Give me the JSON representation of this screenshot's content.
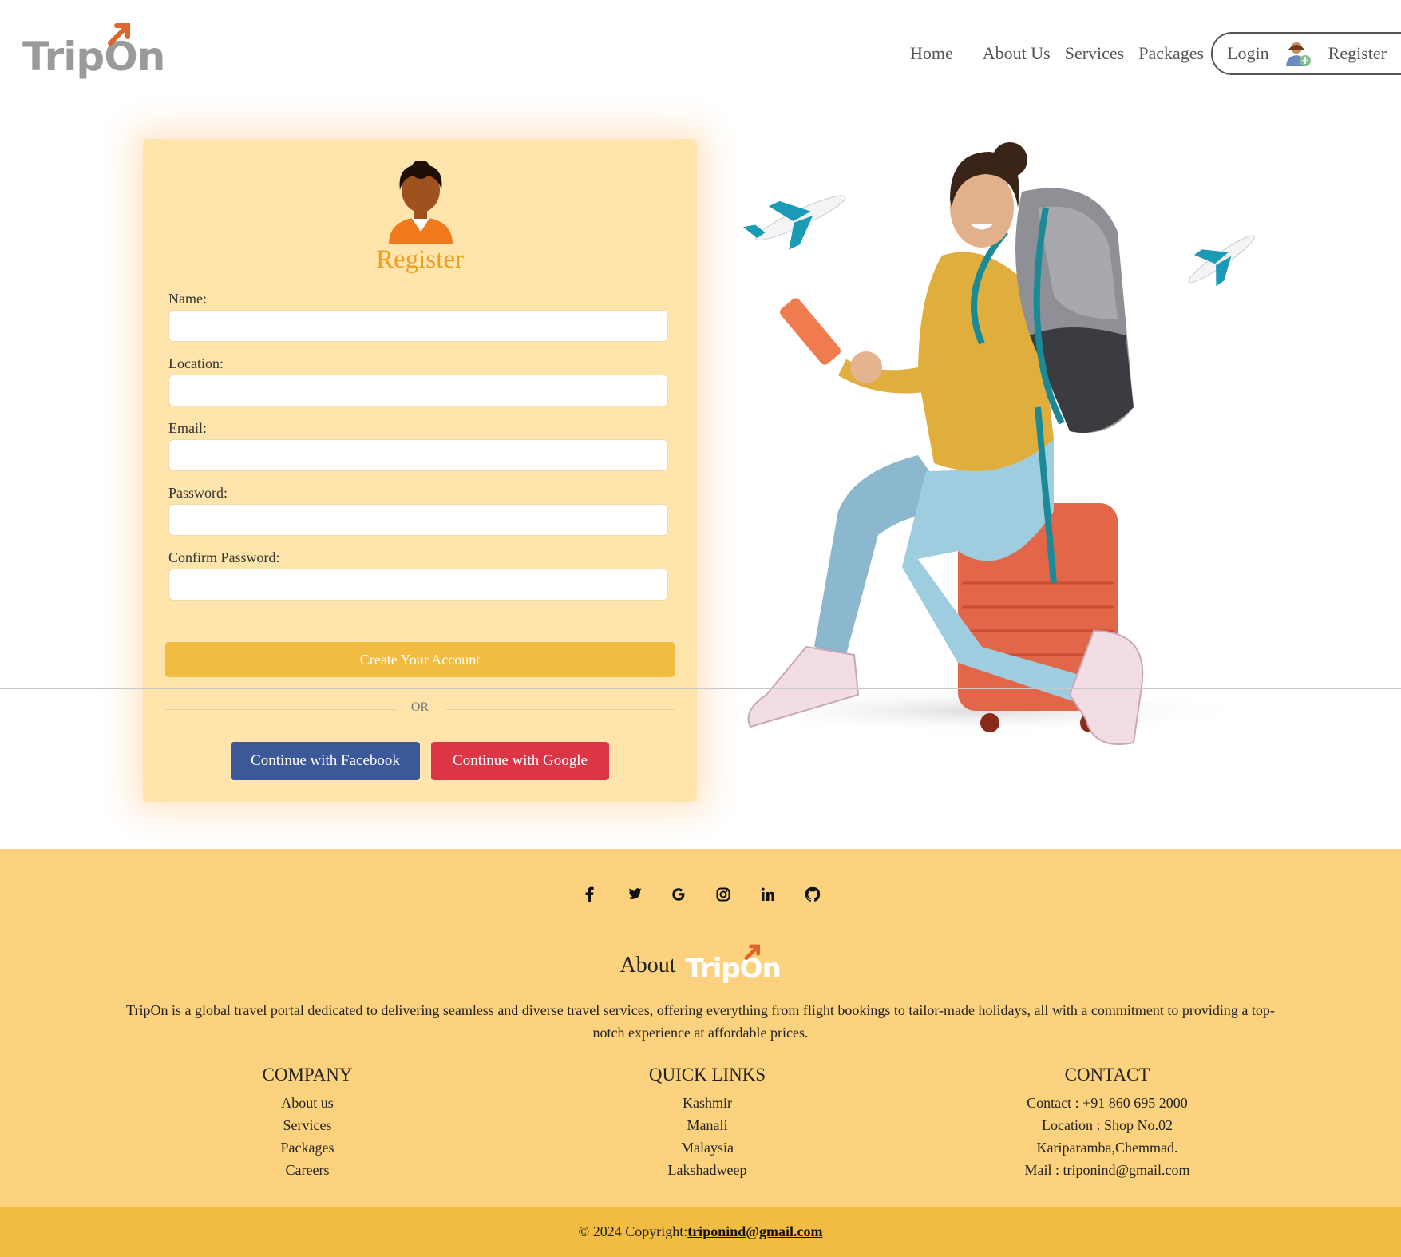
{
  "header": {
    "logo_text": "TripOn",
    "nav": {
      "home": "Home",
      "about": "About Us",
      "services": "Services",
      "packages": "Packages"
    },
    "auth": {
      "login": "Login",
      "register": "Register"
    }
  },
  "register_form": {
    "title": "Register",
    "fields": [
      {
        "label": "Name:",
        "value": ""
      },
      {
        "label": "Location:",
        "value": ""
      },
      {
        "label": "Email:",
        "value": ""
      },
      {
        "label": "Password:",
        "value": ""
      },
      {
        "label": "Confirm Password:",
        "value": ""
      }
    ],
    "submit_label": "Create Your Account",
    "or_text": "OR",
    "facebook_label": "Continue with Facebook",
    "google_label": "Continue with Google"
  },
  "footer": {
    "social_icons": [
      "facebook-icon",
      "twitter-icon",
      "google-icon",
      "instagram-icon",
      "linkedin-icon",
      "github-icon"
    ],
    "about_prefix": "About",
    "about_logo": "TripOn",
    "about_text": "TripOn is a global travel portal dedicated to delivering seamless and diverse travel services, offering everything from flight bookings to tailor-made holidays, all with a commitment to providing a top-notch experience at affordable prices.",
    "company": {
      "title": "COMPANY",
      "items": [
        "About us",
        "Services",
        "Packages",
        "Careers"
      ]
    },
    "quick_links": {
      "title": "QUICK LINKS",
      "items": [
        "Kashmir",
        "Manali",
        "Malaysia",
        "Lakshadweep"
      ]
    },
    "contact": {
      "title": "CONTACT",
      "items": [
        "Contact : +91 860 695 2000",
        "Location : Shop No.02",
        "Kariparamba,Chemmad.",
        "Mail : triponind@gmail.com"
      ]
    },
    "copyright_prefix": "© 2024 Copyright:",
    "copyright_link": " triponind@gmail.com"
  },
  "colors": {
    "accent": "#f2bc42",
    "card_bg": "#ffe4ab",
    "footer_bg": "#fdd27e",
    "facebook": "#3b5998",
    "google": "#dc3545",
    "register_title": "#f0a020"
  }
}
